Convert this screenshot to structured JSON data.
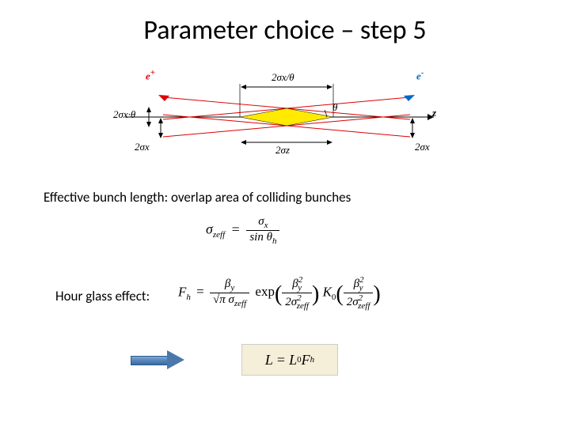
{
  "title": "Parameter choice – step 5",
  "diagram": {
    "tl_label": "e",
    "tl_sign": "+",
    "tr_label": "e",
    "tr_sign": "-",
    "top_horiz": "2σx/θ",
    "left_vert": "2σx·θ",
    "bl_2sigma": "2σx",
    "br_2sigma": "2σx",
    "bottom_2sigmaz": "2σz",
    "angle": "θ",
    "axis": "z"
  },
  "captions": {
    "eff_bunch": "Effective bunch length:   overlap area of colliding bunches",
    "hourglass": "Hour glass effect:"
  },
  "eq1": {
    "lhs_sigma": "σ",
    "lhs_sub": "zeff",
    "num_sigma": "σ",
    "num_sub": "x",
    "den_sin": "sin",
    "den_theta": "θ",
    "den_sub": "h"
  },
  "eq2": {
    "F": "F",
    "F_sub": "h",
    "eq": "=",
    "num_beta": "β",
    "num_sub": "y",
    "den_sqrt_pi": "√π ",
    "den_sigma": "σ",
    "den_sub": "zeff",
    "exp": "exp",
    "K0": "K",
    "K0_sub": "0",
    "in_num_beta": "β",
    "in_num_sup": "2",
    "in_num_sub": "y",
    "in_den_2": "2",
    "in_den_sigma": "σ",
    "in_den_sup": "2",
    "in_den_sub": "zeff"
  },
  "eq3": {
    "L1": "L",
    "eq": "=",
    "L2": "L",
    "zero": "0",
    "F": "F",
    "h": "h"
  }
}
